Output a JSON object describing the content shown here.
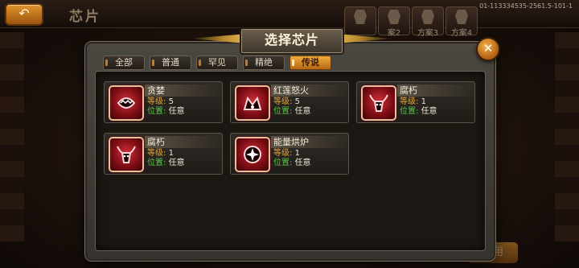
{
  "background": {
    "back_icon": "back-arrow-icon",
    "title": "芯片",
    "version": "01-113334535-2561.5-101-1",
    "scheme_tabs": [
      "",
      "案2",
      "方案3",
      "方案4"
    ],
    "confirm_label": "应用"
  },
  "dialog": {
    "title": "选择芯片",
    "close_icon": "close-icon",
    "filters": [
      {
        "label": "全部",
        "active": false
      },
      {
        "label": "普通",
        "active": false
      },
      {
        "label": "罕见",
        "active": false
      },
      {
        "label": "精绝",
        "active": false
      },
      {
        "label": "传说",
        "active": true
      }
    ],
    "level_key": "等级:",
    "slot_key": "位置:",
    "chips": [
      {
        "name": "贪婪",
        "level": "5",
        "slot": "任意",
        "icon": "maw-icon"
      },
      {
        "name": "红莲怒火",
        "level": "5",
        "slot": "任意",
        "icon": "flame-crown-icon"
      },
      {
        "name": "腐朽",
        "level": "1",
        "slot": "任意",
        "icon": "horned-skull-icon"
      },
      {
        "name": "腐朽",
        "level": "1",
        "slot": "任意",
        "icon": "horned-skull-icon"
      },
      {
        "name": "能量烘炉",
        "level": "1",
        "slot": "任意",
        "icon": "energy-furnace-icon"
      }
    ]
  },
  "colors": {
    "accent_orange": "#f2ad3c",
    "level_key": "#e7a53a",
    "slot_key": "#58c24a",
    "chip_red": "#d0303a"
  }
}
